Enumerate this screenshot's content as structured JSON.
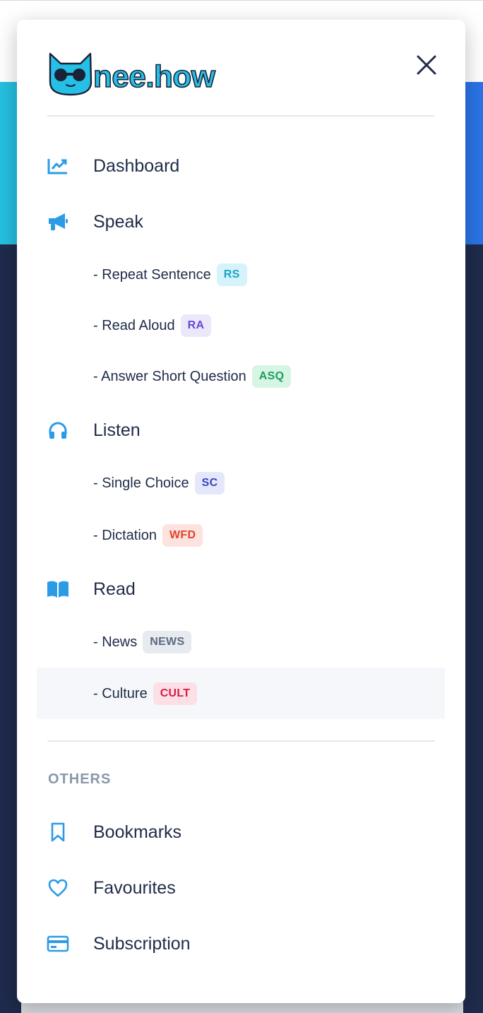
{
  "brand": {
    "name": "nee.how"
  },
  "nav": {
    "dashboard": "Dashboard",
    "speak": "Speak",
    "listen": "Listen",
    "read": "Read"
  },
  "speak_items": [
    {
      "label": "- Repeat Sentence",
      "badge": "RS",
      "badge_bg": "#d4f3fb",
      "badge_fg": "#1aa5c8"
    },
    {
      "label": "- Read Aloud",
      "badge": "RA",
      "badge_bg": "#ebe8fb",
      "badge_fg": "#6a46d8"
    },
    {
      "label": "- Answer Short Question",
      "badge": "ASQ",
      "badge_bg": "#d6f5e4",
      "badge_fg": "#1f9e5c"
    }
  ],
  "listen_items": [
    {
      "label": "- Single Choice",
      "badge": "SC",
      "badge_bg": "#e5e8fa",
      "badge_fg": "#3b43c6"
    },
    {
      "label": "- Dictation",
      "badge": "WFD",
      "badge_bg": "#fde3df",
      "badge_fg": "#e0432a"
    }
  ],
  "read_items": [
    {
      "label": "- News",
      "badge": "NEWS",
      "badge_bg": "#e7eaef",
      "badge_fg": "#5b6b82"
    },
    {
      "label": "- Culture",
      "badge": "CULT",
      "badge_bg": "#fde0e6",
      "badge_fg": "#d81c48",
      "active": true
    }
  ],
  "others": {
    "title": "OTHERS",
    "bookmarks": "Bookmarks",
    "favourites": "Favourites",
    "subscription": "Subscription"
  },
  "icons": {
    "close": "close-icon",
    "dashboard": "chart-line-icon",
    "speak": "megaphone-icon",
    "listen": "headphones-icon",
    "read": "book-open-icon",
    "bookmarks": "bookmark-icon",
    "favourites": "heart-icon",
    "subscription": "credit-card-icon"
  },
  "colors": {
    "accent": "#2c9be6",
    "text": "#1f2b48",
    "muted": "#8a98aa"
  }
}
